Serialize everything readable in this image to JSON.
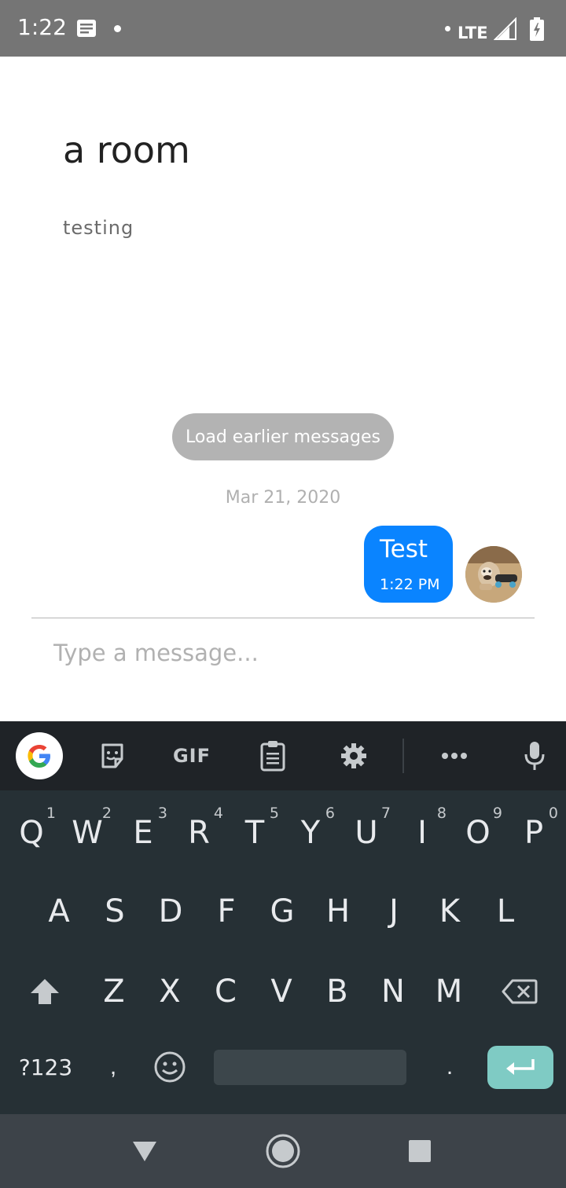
{
  "status_bar": {
    "time": "1:22",
    "network": "LTE",
    "icons": [
      "message-icon",
      "notification-dot-icon",
      "signal-icon",
      "battery-charging-icon"
    ]
  },
  "room": {
    "title": "a room",
    "subtitle": "testing"
  },
  "chat": {
    "load_earlier_label": "Load earlier messages",
    "day_label": "Mar 21, 2020",
    "messages": [
      {
        "text": "Test",
        "time": "1:22 PM",
        "outgoing": true,
        "bubble_color": "#0a84ff"
      }
    ],
    "composer_placeholder": "Type a message..."
  },
  "keyboard": {
    "toolbar_icons": [
      "google-icon",
      "sticker-icon",
      "gif-icon",
      "clipboard-icon",
      "settings-icon",
      "more-icon",
      "microphone-icon"
    ],
    "gif_label": "GIF",
    "row1": [
      "Q",
      "W",
      "E",
      "R",
      "T",
      "Y",
      "U",
      "I",
      "O",
      "P"
    ],
    "row1_hints": [
      "1",
      "2",
      "3",
      "4",
      "5",
      "6",
      "7",
      "8",
      "9",
      "0"
    ],
    "row2": [
      "A",
      "S",
      "D",
      "F",
      "G",
      "H",
      "J",
      "K",
      "L"
    ],
    "row3": [
      "Z",
      "X",
      "C",
      "V",
      "B",
      "N",
      "M"
    ],
    "symbols_label": "?123",
    "comma_label": ",",
    "period_label": ".",
    "enter_color": "#7fcbc4"
  },
  "nav_bar": {
    "buttons": [
      "back-icon",
      "home-icon",
      "recents-icon"
    ]
  }
}
